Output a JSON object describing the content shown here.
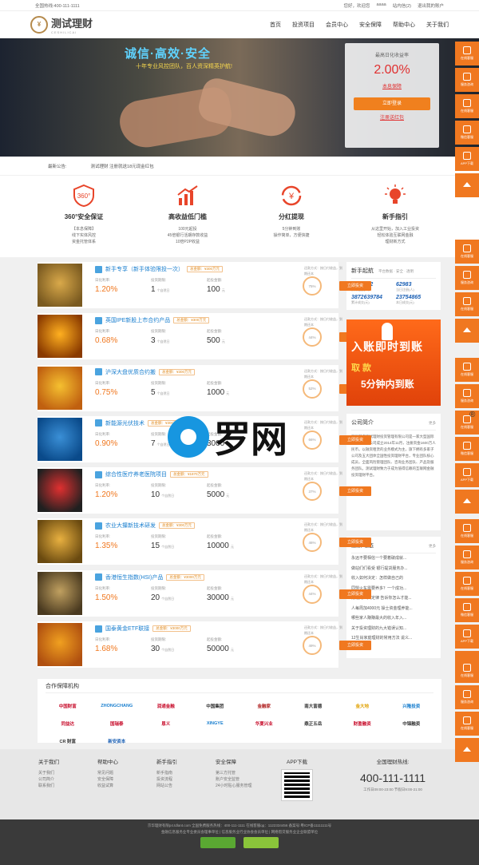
{
  "topbar": {
    "hotline": "全国热线:400-111-1111",
    "links": [
      "您好，欢迎您",
      "aaaa",
      "站内信(2)",
      "退出我的账户"
    ]
  },
  "header": {
    "logo_name": "测试理财",
    "logo_en": "CESHILICAI",
    "nav": [
      "首页",
      "投资项目",
      "会员中心",
      "安全保障",
      "帮助中心",
      "关于我们"
    ]
  },
  "banner": {
    "slogan": "诚信·高效·安全",
    "sub": "十年专业风控团队，百人资深精英护航!"
  },
  "login_box": {
    "title": "最高日化收益率",
    "rate": "2.00%",
    "link": "本息保障",
    "button": "立即登录",
    "register": "注册送红包"
  },
  "notice": {
    "label": "最新公告:",
    "text": "测试理财 注册就送18元现金红包"
  },
  "features": [
    {
      "title": "360°安全保证",
      "desc": "【本息保障】\n线下实体风控\n资金托管体系",
      "icon": "shield-360-icon"
    },
    {
      "title": "高收益低门槛",
      "desc": "100元起投\n45倍银行活期存款收益\n10倍P2P收益",
      "icon": "chart-up-icon"
    },
    {
      "title": "分红提现",
      "desc": "5分钟到账\n操作简单，方便快捷",
      "icon": "refresh-money-icon"
    },
    {
      "title": "新手指引",
      "desc": "从这里开始，加入工业投资\n轻松体验互联网金融\n理财新方式",
      "icon": "lightbulb-icon"
    }
  ],
  "products": [
    {
      "title": "新手专享（新手体验限投一次）",
      "badge": "总金额：¥300万元",
      "rate": "1.20%",
      "term": "1",
      "amount": "100",
      "img": "#d9a94a",
      "img2": "#7a5a20",
      "pct": "75%"
    },
    {
      "title": "英国IPE新股上市合约产品",
      "badge": "总金额：¥300万元",
      "rate": "0.68%",
      "term": "3",
      "amount": "500",
      "img": "#ffb020",
      "img2": "#8a3a00",
      "pct": "44%"
    },
    {
      "title": "沪深大盘优质合约搬",
      "badge": "总金额：¥300万元",
      "rate": "0.75%",
      "term": "5",
      "amount": "1000",
      "img": "#f5c030",
      "img2": "#c06010",
      "pct": "52%"
    },
    {
      "title": "新能源光伏技术",
      "badge": "总金额：¥300万元",
      "rate": "0.90%",
      "term": "7",
      "amount": "3000",
      "img": "#3a8fd6",
      "img2": "#0a4a8a",
      "pct": "66%"
    },
    {
      "title": "综合性医疗养老医院项目",
      "badge": "总金额：¥1870万元",
      "rate": "1.20%",
      "term": "10",
      "amount": "5000",
      "img": "#e03030",
      "img2": "#202020",
      "pct": "37%"
    },
    {
      "title": "农业大攥新技术研发",
      "badge": "总金额：¥300万元",
      "rate": "1.35%",
      "term": "15",
      "amount": "10000",
      "img": "#e8b040",
      "img2": "#6a4a10",
      "pct": "46%"
    },
    {
      "title": "香港恒生指数(HSI)产品",
      "badge": "总金额：¥3000万元",
      "rate": "1.50%",
      "term": "20",
      "amount": "30000",
      "img": "#c0a060",
      "img2": "#4a3a20",
      "pct": "44%"
    },
    {
      "title": "国泰黄金ETF联接",
      "badge": "总金额：¥3000万元",
      "rate": "1.68%",
      "term": "30",
      "amount": "50000",
      "img": "#f0a020",
      "img2": "#b05010",
      "pct": "49%"
    }
  ],
  "product_labels": {
    "rate": "日化利率:",
    "term": "投资期限:",
    "amount": "起投金额:",
    "meta": "还款方式：按日付收益，到期还本",
    "btn": "立即投资",
    "rate_unit": "",
    "term_unit": "个自然日",
    "amount_unit": "元"
  },
  "stats_box": {
    "title": "新手起航",
    "sub": "平台数据 · 安全 · 透明",
    "items": [
      {
        "v": "8763422",
        "l": "累计注册(人)"
      },
      {
        "v": "62983",
        "l": "当日注册(人)"
      },
      {
        "v": "3872639784",
        "l": "累计成交(元)"
      },
      {
        "v": "23754865",
        "l": "本日成交(元)"
      }
    ]
  },
  "ad": {
    "t1": "入账即时到账",
    "t2": "取 款",
    "t3": "5分钟内到账"
  },
  "company": {
    "title": "公司简介",
    "more": "更多",
    "text": "深圳前海测试理财投资管理有限公司是一家大型国际投资公司。公司成立2014年11月，注册资金1600万人民币。以融资租赁的业务模式为主，旗下拥有多家子公司及五大团体全国性投资理财平台，专业团队核心成员，全面风险管理团队、咨询业务团队、产品及服务团队。测试理财致力于成为值得信赖的互联网金融投资理财平台。"
  },
  "news": {
    "title": "最新动态",
    "more": "更多",
    "items": [
      "永远不要相信一个要着破成就...",
      "做站们们看受 银行提货服务办...",
      "收入如何决定：怎样做自己的",
      "同盟火车需要养多？一个成功...",
      "赚钱的八大定律 告诉你怎么才能...",
      "人每周加4000元 操士资金理养能...",
      "哪些家人赚赚最大的收入年入...",
      "关于投资理财的九大错误认知...",
      "12生肖家庭理财的常用方法 说义..."
    ]
  },
  "partners": {
    "title": "合作保障机构",
    "logos": [
      {
        "n": "中国财富",
        "c": "#c8102e"
      },
      {
        "n": "ZHONGCHANG",
        "c": "#1a7fcf"
      },
      {
        "n": "润通金融",
        "c": "#c8102e"
      },
      {
        "n": "中国集团",
        "c": "#333"
      },
      {
        "n": "金融家",
        "c": "#b02020"
      },
      {
        "n": "南大富德",
        "c": "#333"
      },
      {
        "n": "金大地",
        "c": "#e0a000"
      },
      {
        "n": "兴隆投资",
        "c": "#1a7fcf"
      },
      {
        "n": "同益达",
        "c": "#c8102e"
      },
      {
        "n": "国瑞泰",
        "c": "#c8102e"
      },
      {
        "n": "恩义",
        "c": "#c8102e"
      },
      {
        "n": "XINGYE",
        "c": "#1a7fcf"
      },
      {
        "n": "华夏兴业",
        "c": "#c8102e"
      },
      {
        "n": "鼎正五岳",
        "c": "#333"
      },
      {
        "n": "财盈融资",
        "c": "#c8102e"
      },
      {
        "n": "中锦融资",
        "c": "#333"
      },
      {
        "n": "CR 财富",
        "c": "#333"
      },
      {
        "n": "新安资本",
        "c": "#1a5fb4"
      }
    ]
  },
  "footer": {
    "cols": [
      {
        "title": "关于我们",
        "items": [
          "关于我们",
          "公司简介",
          "联系我们"
        ]
      },
      {
        "title": "帮助中心",
        "items": [
          "常见问题",
          "安全保障",
          "收益试算"
        ]
      },
      {
        "title": "新手指引",
        "items": [
          "新手指南",
          "投资流程",
          "网站公告"
        ]
      },
      {
        "title": "安全保障",
        "items": [
          "第三方托管",
          "账户安全监管",
          "24小时贴心服务管理"
        ]
      }
    ],
    "app": "APP下载",
    "hot_title": "全国理财热线:",
    "hot_num": "400-111-1111",
    "hot_time": "工作日09:00-23:00 节假日9:00-21:00"
  },
  "copyright": {
    "line1": "京华理财有限p4.tdlant.com 全国免费服务热线：400-111-1111 在线客服qq：1122334456 备案号:粤ICP备11111111号",
    "line2": "金融信息服务业专业委员会理事单位 | 信息服务业行业协会会员单位 | 网络借贷服务业企业联盟单位"
  },
  "side": {
    "labels": [
      "在线客服",
      "服务咨询",
      "在线客服",
      "微信客服",
      "APP下载"
    ]
  },
  "watermark": {
    "text": "罗网",
    "reg": "®"
  }
}
